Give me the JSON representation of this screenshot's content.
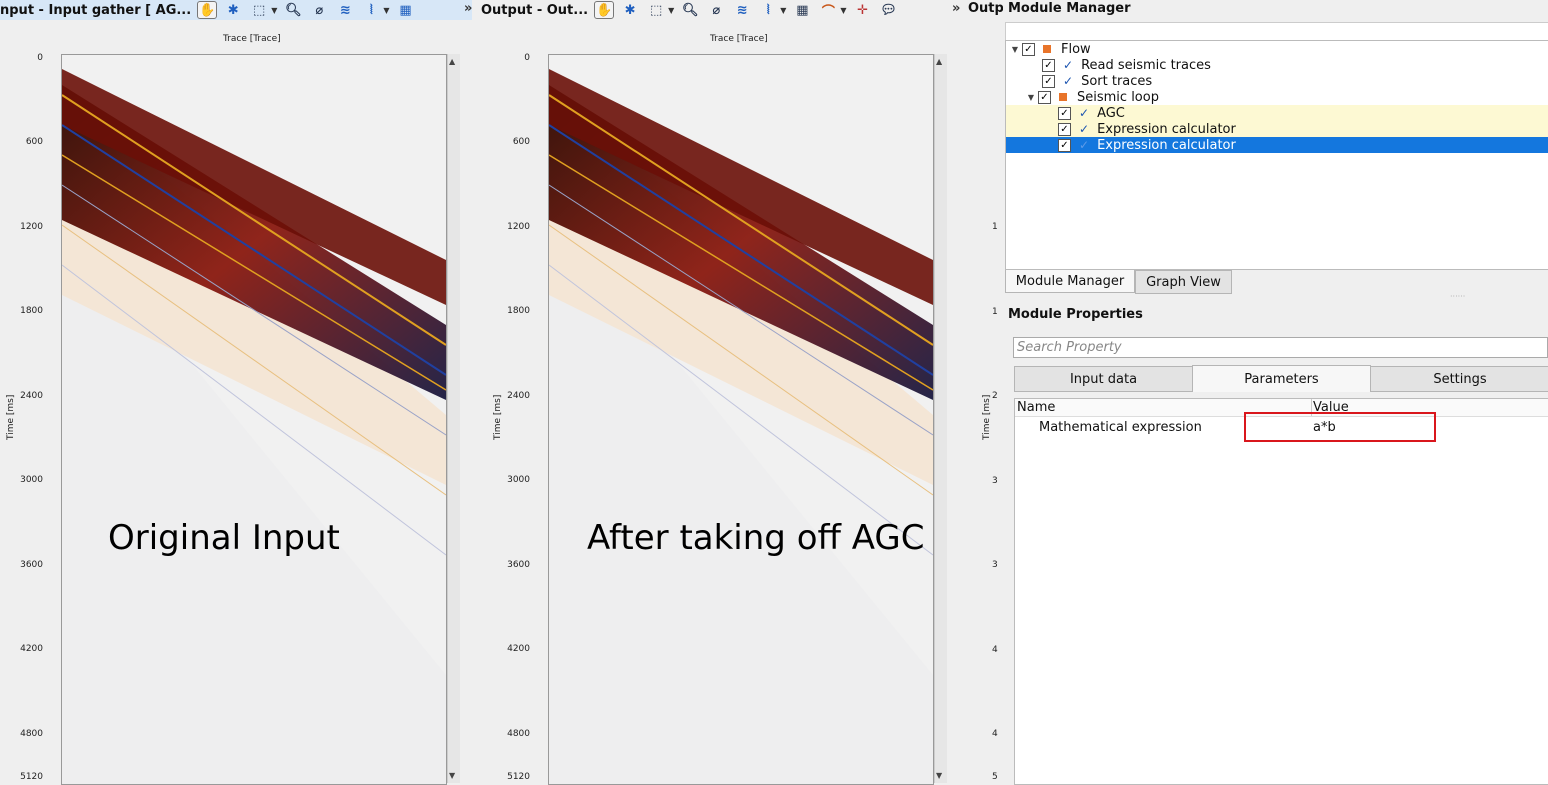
{
  "toolbar_left": {
    "title": "nput - Input gather [ AG..."
  },
  "toolbar_mid": {
    "title": "Output - Out..."
  },
  "toolbar_right": {
    "title": "Outp"
  },
  "overflow_chevron": "»",
  "panel_left": {
    "x_axis_label": "Trace [Trace]",
    "y_axis_label": "Time [ms]",
    "y_ticks": [
      "0",
      "600",
      "1200",
      "1800",
      "2400",
      "3000",
      "3600",
      "4200",
      "4800",
      "5120"
    ],
    "annotation": "Original Input"
  },
  "panel_mid": {
    "x_axis_label": "Trace [Trace]",
    "y_axis_label": "Time [ms]",
    "y_ticks": [
      "0",
      "600",
      "1200",
      "1800",
      "2400",
      "3000",
      "3600",
      "4200",
      "4800",
      "5120"
    ],
    "annotation": "After taking off AGC"
  },
  "panel_right_partial": {
    "y_axis_label": "Time [ms]",
    "y_ticks": [
      "1",
      "1",
      "2",
      "3",
      "3",
      "4",
      "4",
      "5"
    ]
  },
  "module_manager": {
    "title": "Module Manager",
    "tree": [
      {
        "label": "Flow",
        "level": 0,
        "type": "group",
        "checked": true
      },
      {
        "label": "Read seismic traces",
        "level": 1,
        "type": "module",
        "checked": true
      },
      {
        "label": "Sort traces",
        "level": 1,
        "type": "module",
        "checked": true
      },
      {
        "label": "Seismic loop",
        "level": 1,
        "type": "group",
        "checked": true
      },
      {
        "label": "AGC",
        "level": 2,
        "type": "module",
        "checked": true,
        "highlight": true
      },
      {
        "label": "Expression calculator",
        "level": 2,
        "type": "module",
        "checked": true,
        "highlight": true
      },
      {
        "label": "Expression calculator",
        "level": 2,
        "type": "module",
        "checked": true,
        "selected": true
      }
    ],
    "tabs": [
      "Module Manager",
      "Graph View"
    ],
    "active_tab": "Module Manager"
  },
  "module_properties": {
    "title": "Module Properties",
    "search_placeholder": "Search Property",
    "tabs": [
      "Input data",
      "Parameters",
      "Settings"
    ],
    "active_tab": "Parameters",
    "columns": [
      "Name",
      "Value"
    ],
    "rows": [
      {
        "name": "Mathematical expression",
        "value": "a*b"
      }
    ]
  },
  "colors": {
    "selection": "#1477de",
    "highlight": "#fdf9d3",
    "annotation_box": "#d9161c",
    "group_square": "#e8742a"
  }
}
